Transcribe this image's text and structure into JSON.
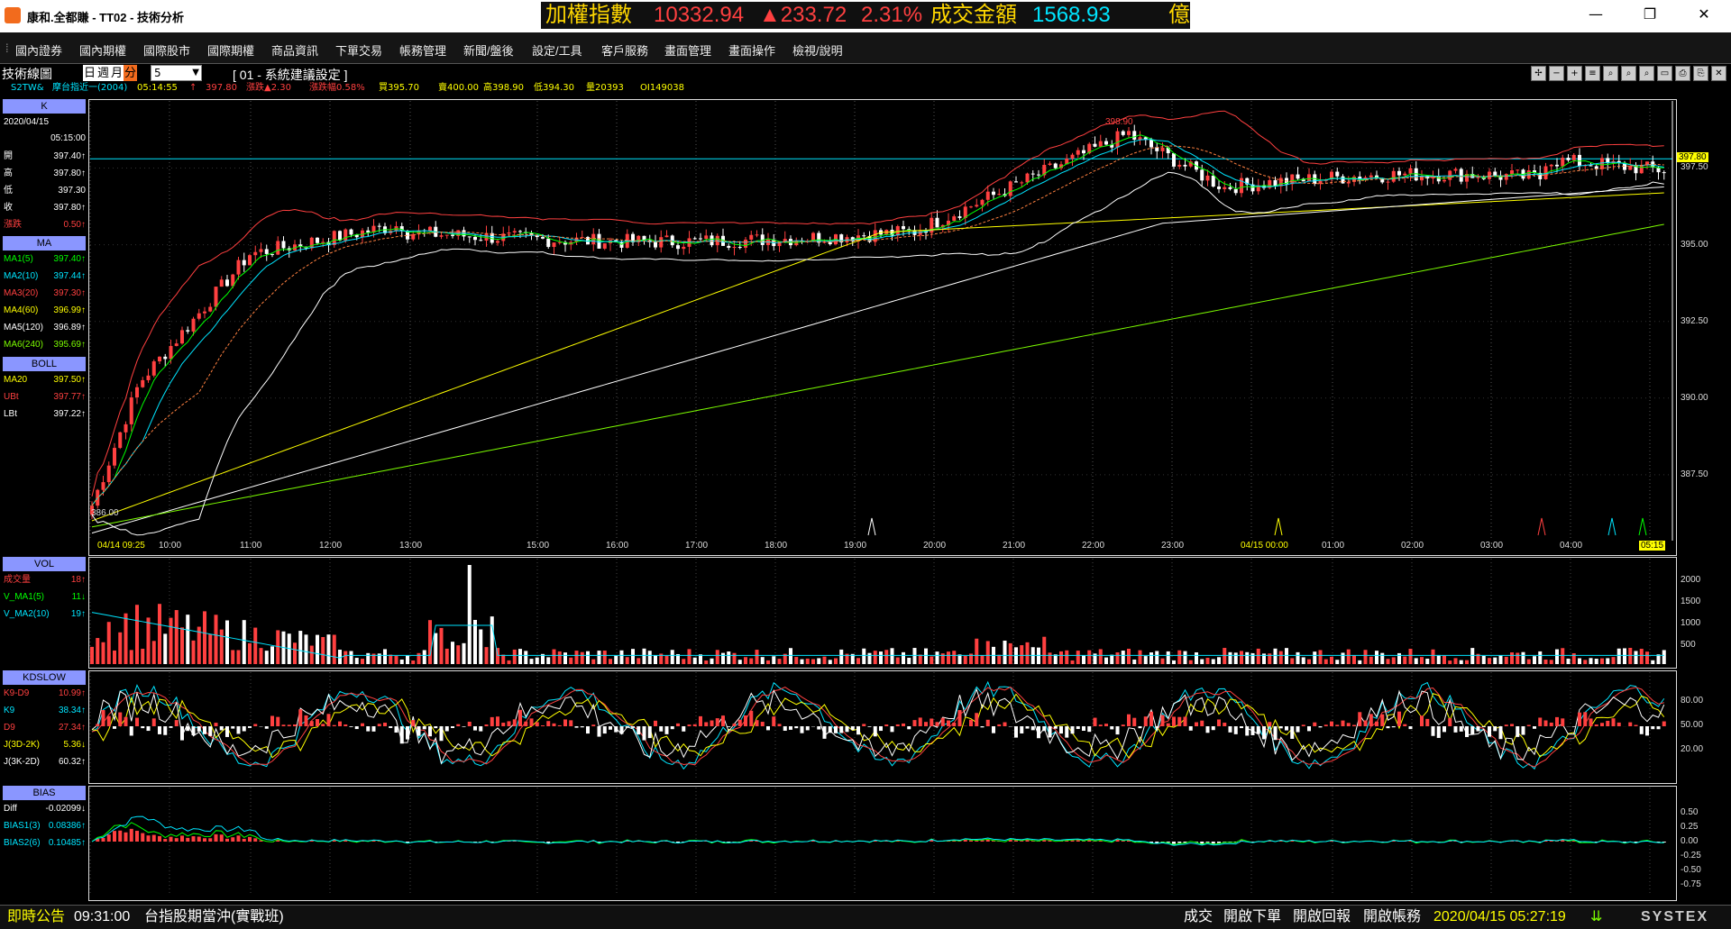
{
  "window": {
    "title": "康和.全都賺 - TT02 - 技術分析",
    "minimize": "—",
    "restore": "❐",
    "close": "✕"
  },
  "ticker": {
    "name": "加權指數",
    "index": "10332.94",
    "change": "▲233.72",
    "pct": "2.31%",
    "turnover_label": "成交金額",
    "turnover": "1568.93",
    "unit": "億"
  },
  "menu": [
    "國內證券",
    "國內期權",
    "國際股市",
    "國際期權",
    "商品資訊",
    "下單交易",
    "帳務管理",
    "新聞/盤後",
    "設定/工具",
    "客戶服務",
    "畫面管理",
    "畫面操作",
    "檢視/說明"
  ],
  "toolbar": {
    "title": "技術線圖",
    "periods": [
      "日",
      "週",
      "月",
      "分"
    ],
    "selected_period": "分",
    "interval": "5",
    "setting": "[ 01 - 系統建議設定 ]",
    "tools": [
      "✢",
      "−",
      "+",
      "≡",
      "⌕",
      "⌕",
      "⌕",
      "▭",
      "⎙",
      "⎘",
      "✕"
    ]
  },
  "quote": {
    "symbol": "S2TW&",
    "name": "摩台指近一(2004)",
    "time": "05:14:55",
    "arrow": "↑",
    "price": "397.80",
    "change": "漲跌▲2.30",
    "pct": "漲跌幅0.58%",
    "bid": "買395.70",
    "ask": "賣400.00",
    "high": "高398.90",
    "low": "低394.30",
    "volume": "量20393",
    "oi": "OI149038"
  },
  "left_panel": {
    "k_header": "K",
    "date": "2020/04/15",
    "time": "05:15:00",
    "k_rows": [
      {
        "k": "開",
        "v": "397.40↑",
        "c": "#fff"
      },
      {
        "k": "高",
        "v": "397.80↑",
        "c": "#fff"
      },
      {
        "k": "低",
        "v": "397.30",
        "c": "#fff"
      },
      {
        "k": "收",
        "v": "397.80↑",
        "c": "#fff"
      },
      {
        "k": "漲跌",
        "v": "0.50↑",
        "c": "#ff4040"
      }
    ],
    "ma_header": "MA",
    "ma_rows": [
      {
        "k": "MA1(5)",
        "v": "397.40↑",
        "c": "#00ff00"
      },
      {
        "k": "MA2(10)",
        "v": "397.44↑",
        "c": "#00e5ff"
      },
      {
        "k": "MA3(20)",
        "v": "397.30↑",
        "c": "#ff4040"
      },
      {
        "k": "MA4(60)",
        "v": "396.99↑",
        "c": "#ffff00"
      },
      {
        "k": "MA5(120)",
        "v": "396.89↑",
        "c": "#ffffff"
      },
      {
        "k": "MA6(240)",
        "v": "395.69↑",
        "c": "#7cfc00"
      }
    ],
    "boll_header": "BOLL",
    "boll_rows": [
      {
        "k": "MA20",
        "v": "397.50↑",
        "c": "#ffff00"
      },
      {
        "k": "UBt",
        "v": "397.77↑",
        "c": "#ff4040"
      },
      {
        "k": "LBt",
        "v": "397.22↑",
        "c": "#ffffff"
      }
    ],
    "vol_header": "VOL",
    "vol_rows": [
      {
        "k": "成交量",
        "v": "18↑",
        "c": "#ff4040"
      },
      {
        "k": "V_MA1(5)",
        "v": "11↓",
        "c": "#00ff00"
      },
      {
        "k": "V_MA2(10)",
        "v": "19↑",
        "c": "#00e5ff"
      }
    ],
    "kd_header": "KDSLOW",
    "kd_rows": [
      {
        "k": "K9-D9",
        "v": "10.99↑",
        "c": "#ff4040"
      },
      {
        "k": "K9",
        "v": "38.34↑",
        "c": "#00e5ff"
      },
      {
        "k": "D9",
        "v": "27.34↑",
        "c": "#ff4040"
      },
      {
        "k": "J(3D-2K)",
        "v": "5.36↓",
        "c": "#ffff00"
      },
      {
        "k": "J(3K-2D)",
        "v": "60.32↑",
        "c": "#ffffff"
      }
    ],
    "bias_header": "BIAS",
    "bias_rows": [
      {
        "k": "Diff",
        "v": "-0.02099↓",
        "c": "#ffffff"
      },
      {
        "k": "BIAS1(3)",
        "v": "0.08386↑",
        "c": "#00e5ff"
      },
      {
        "k": "BIAS2(6)",
        "v": "0.10485↑",
        "c": "#00e5ff"
      }
    ]
  },
  "main_chart": {
    "price_axis": [
      "397.50",
      "395.00",
      "392.50",
      "390.00",
      "387.50"
    ],
    "current_price": "397.80",
    "high_label": "398.90",
    "low_label": "386.00",
    "time_axis": [
      "04/14 09:25",
      "10:00",
      "11:00",
      "12:00",
      "13:00",
      "15:00",
      "16:00",
      "17:00",
      "18:00",
      "19:00",
      "20:00",
      "21:00",
      "22:00",
      "23:00",
      "04/15 00:00",
      "01:00",
      "02:00",
      "03:00",
      "04:00",
      "05:15"
    ]
  },
  "vol_axis": [
    "2000",
    "1500",
    "1000",
    "500"
  ],
  "kd_axis": [
    "80.00",
    "50.00",
    "20.00"
  ],
  "bias_axis": [
    "0.50",
    "0.25",
    "0.00",
    "-0.25",
    "-0.50",
    "-0.75"
  ],
  "status": {
    "announce": "即時公告",
    "time": "09:31:00",
    "message": "台指股期當沖(實戰班)",
    "trade": "成交",
    "order": "開啟下單",
    "report": "開啟回報",
    "account": "開啟帳務",
    "datetime": "2020/04/15 05:27:19",
    "brand": "SYSTEX"
  },
  "colors": {
    "up": "#ff4040",
    "down": "#ffffff",
    "ma1": "#00ff00",
    "ma2": "#00e5ff",
    "ma3": "#ff4040",
    "ma4": "#ffff00",
    "ma5": "#ffffff",
    "ma6": "#7cfc00",
    "accent": "#f26b1d"
  }
}
